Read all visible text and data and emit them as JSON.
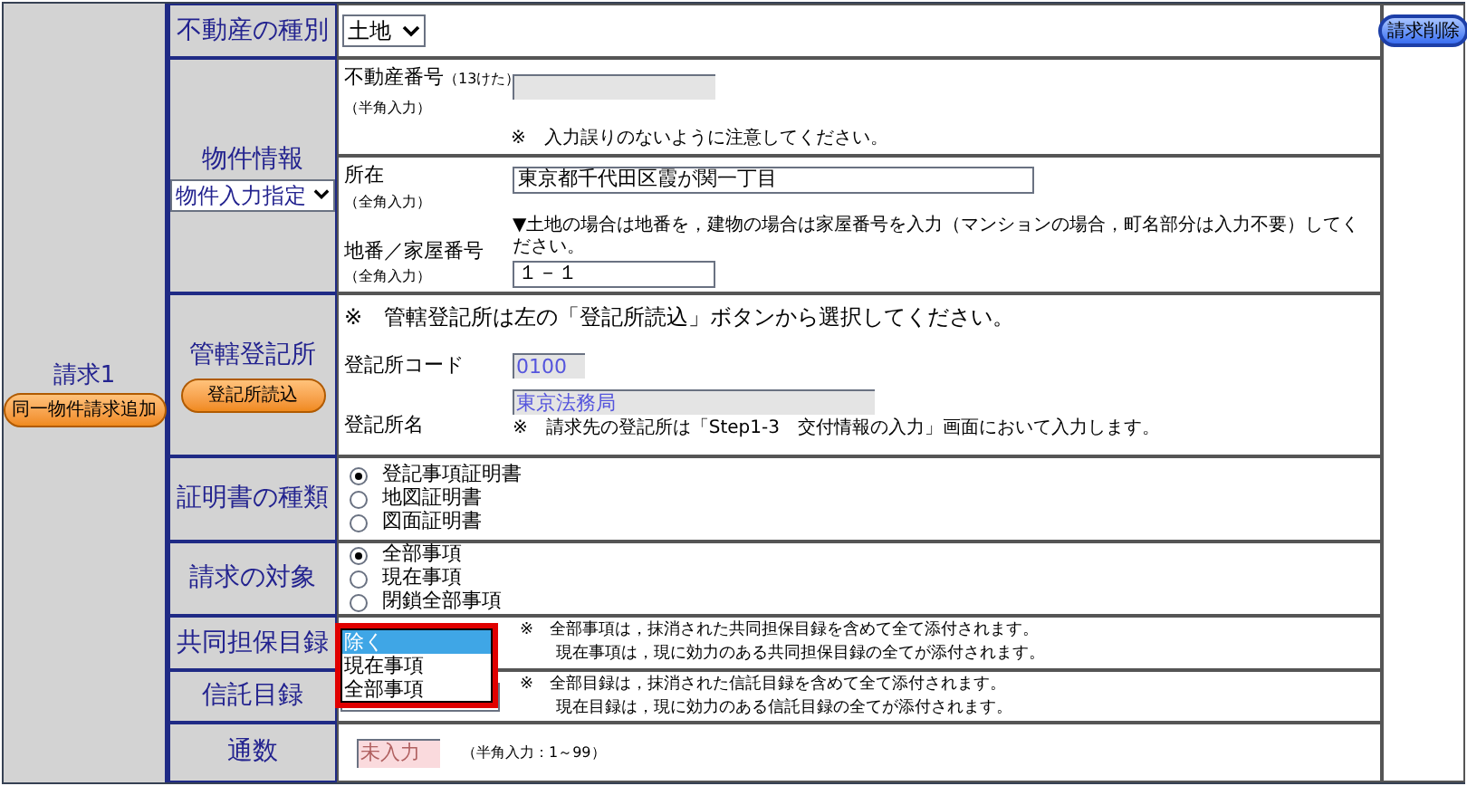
{
  "request": {
    "title": "請求1",
    "add_button": "同一物件請求追加",
    "delete_button": "請求削除"
  },
  "property_type": {
    "label": "不動産の種別",
    "value": "土地"
  },
  "property_info": {
    "label": "物件情報",
    "mode": "物件入力指定",
    "number_label": "不動産番号",
    "number_hint": "（13けた）",
    "number_note": "（半角入力）",
    "number_warning": "※　入力誤りのないように注意してください。",
    "location_label": "所在",
    "location_note": "（全角入力）",
    "location_value": "東京都千代田区霞が関一丁目",
    "lot_label": "地番／家屋番号",
    "lot_note": "（全角入力）",
    "lot_instruction": "▼土地の場合は地番を，建物の場合は家屋番号を入力（マンションの場合，町名部分は入力不要）してください。",
    "lot_value": "１－１"
  },
  "registry": {
    "label": "管轄登記所",
    "button": "登記所読込",
    "instruction": "※　管轄登記所は左の「登記所読込」ボタンから選択してください。",
    "code_label": "登記所コード",
    "code_value": "0100",
    "name_label": "登記所名",
    "name_value": "東京法務局",
    "name_note": "※　請求先の登記所は「Step1-3　交付情報の入力」画面において入力します。"
  },
  "certificate_type": {
    "label": "証明書の種類",
    "options": [
      {
        "label": "登記事項証明書",
        "selected": true
      },
      {
        "label": "地図証明書",
        "selected": false
      },
      {
        "label": "図面証明書",
        "selected": false
      }
    ]
  },
  "scope": {
    "label": "請求の対象",
    "options": [
      {
        "label": "全部事項",
        "selected": true
      },
      {
        "label": "現在事項",
        "selected": false
      },
      {
        "label": "閉鎖全部事項",
        "selected": false
      }
    ]
  },
  "joint_collateral": {
    "label": "共同担保目録",
    "dropdown_options": [
      {
        "label": "除く",
        "selected": true
      },
      {
        "label": "現在事項",
        "selected": false
      },
      {
        "label": "全部事項",
        "selected": false
      }
    ],
    "notes": [
      "※　全部事項は，抹消された共同担保目録を含めて全て添付されます。",
      "現在事項は，現に効力のある共同担保目録の全てが添付されます。"
    ]
  },
  "trust": {
    "label": "信託目録",
    "notes": [
      "※　全部目録は，抹消された信託目録を含めて全て添付されます。",
      "現在目録は，現に効力のある信託目録の全てが添付されます。"
    ]
  },
  "copies": {
    "label": "通数",
    "placeholder": "未入力",
    "note": "（半角入力：1～99）"
  }
}
